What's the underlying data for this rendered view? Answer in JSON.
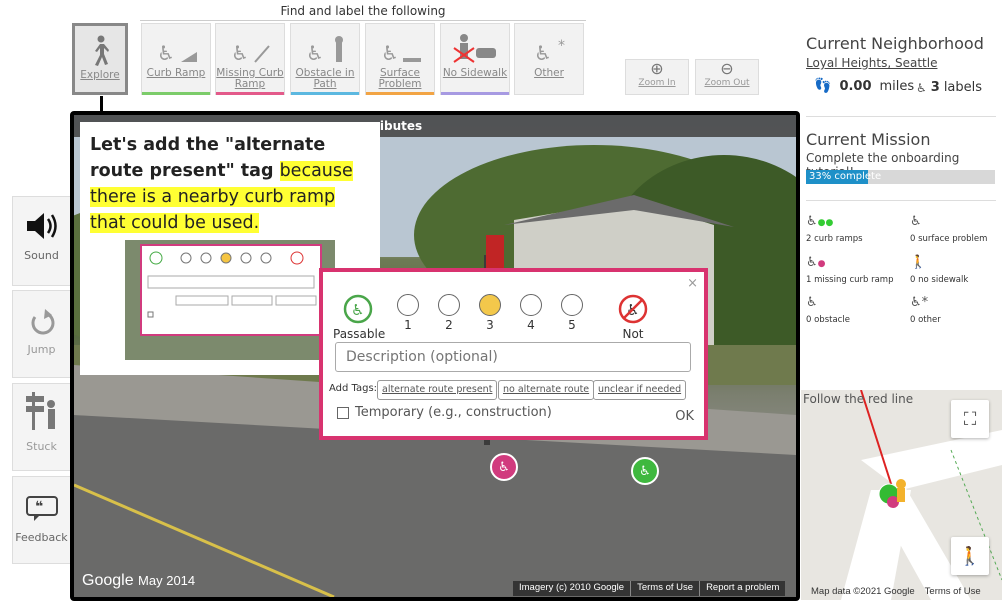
{
  "toolbar": {
    "find_label": "Find and label the following",
    "tools": [
      {
        "label": "Explore",
        "icon": "walking-person-icon"
      },
      {
        "label": "Curb Ramp",
        "icon": "curb-ramp-icon",
        "color": "#7ccc6a"
      },
      {
        "label": "Missing Curb Ramp",
        "icon": "missing-curb-ramp-icon",
        "color": "#e35a8a"
      },
      {
        "label": "Obstacle in Path",
        "icon": "obstacle-icon",
        "color": "#5cb8e0"
      },
      {
        "label": "Surface Problem",
        "icon": "surface-problem-icon",
        "color": "#f2a444"
      },
      {
        "label": "No Sidewalk",
        "icon": "no-sidewalk-icon",
        "color": "#a79ae2"
      },
      {
        "label": "Other",
        "icon": "other-icon"
      }
    ],
    "zoom_in": "Zoom In",
    "zoom_out": "Zoom Out"
  },
  "side_buttons": {
    "sound": "Sound",
    "jump": "Jump",
    "stuck": "Stuck",
    "feedback": "Feedback"
  },
  "pano": {
    "title": "ributes",
    "google": "Google",
    "date": "May 2014",
    "footer": [
      "Imagery (c) 2010 Google",
      "Terms of Use",
      "Report a problem"
    ]
  },
  "tutorial": {
    "text_bold": "Let's add the \"alternate route present\" tag ",
    "text_highlight": "because there is a nearby curb ramp that could be used."
  },
  "dialog": {
    "passable": "Passable",
    "not_passable": "Not Passable",
    "levels": [
      "1",
      "2",
      "3",
      "4",
      "5"
    ],
    "description_placeholder": "Description (optional)",
    "add_tags_label": "Add Tags:",
    "tags": [
      "alternate route present",
      "no alternate route",
      "unclear if needed"
    ],
    "temporary_label": "Temporary (e.g., construction)",
    "ok_label": "OK",
    "close": "×"
  },
  "right_panel": {
    "neighborhood_header": "Current Neighborhood",
    "neighborhood_name": "Loyal Heights, Seattle",
    "miles_value": "0.00",
    "miles_unit": "miles",
    "labels_value": "3",
    "labels_unit": "labels",
    "mission_header": "Current Mission",
    "mission_text": "Complete the onboarding tutorial!",
    "progress_text": "33% complete",
    "progress_fraction": 0.33,
    "label_counts": [
      "2 curb ramps",
      "0 surface problem",
      "1 missing curb ramp",
      "0 no sidewalk",
      "0 obstacle",
      "0 other"
    ]
  },
  "minimap": {
    "hint": "Follow the red line",
    "data": "Map data ©2021 Google",
    "terms": "Terms of Use"
  },
  "colors": {
    "accent_pink": "#d8336f",
    "progress_blue": "#1e90c8",
    "highlight": "#ffff33"
  }
}
